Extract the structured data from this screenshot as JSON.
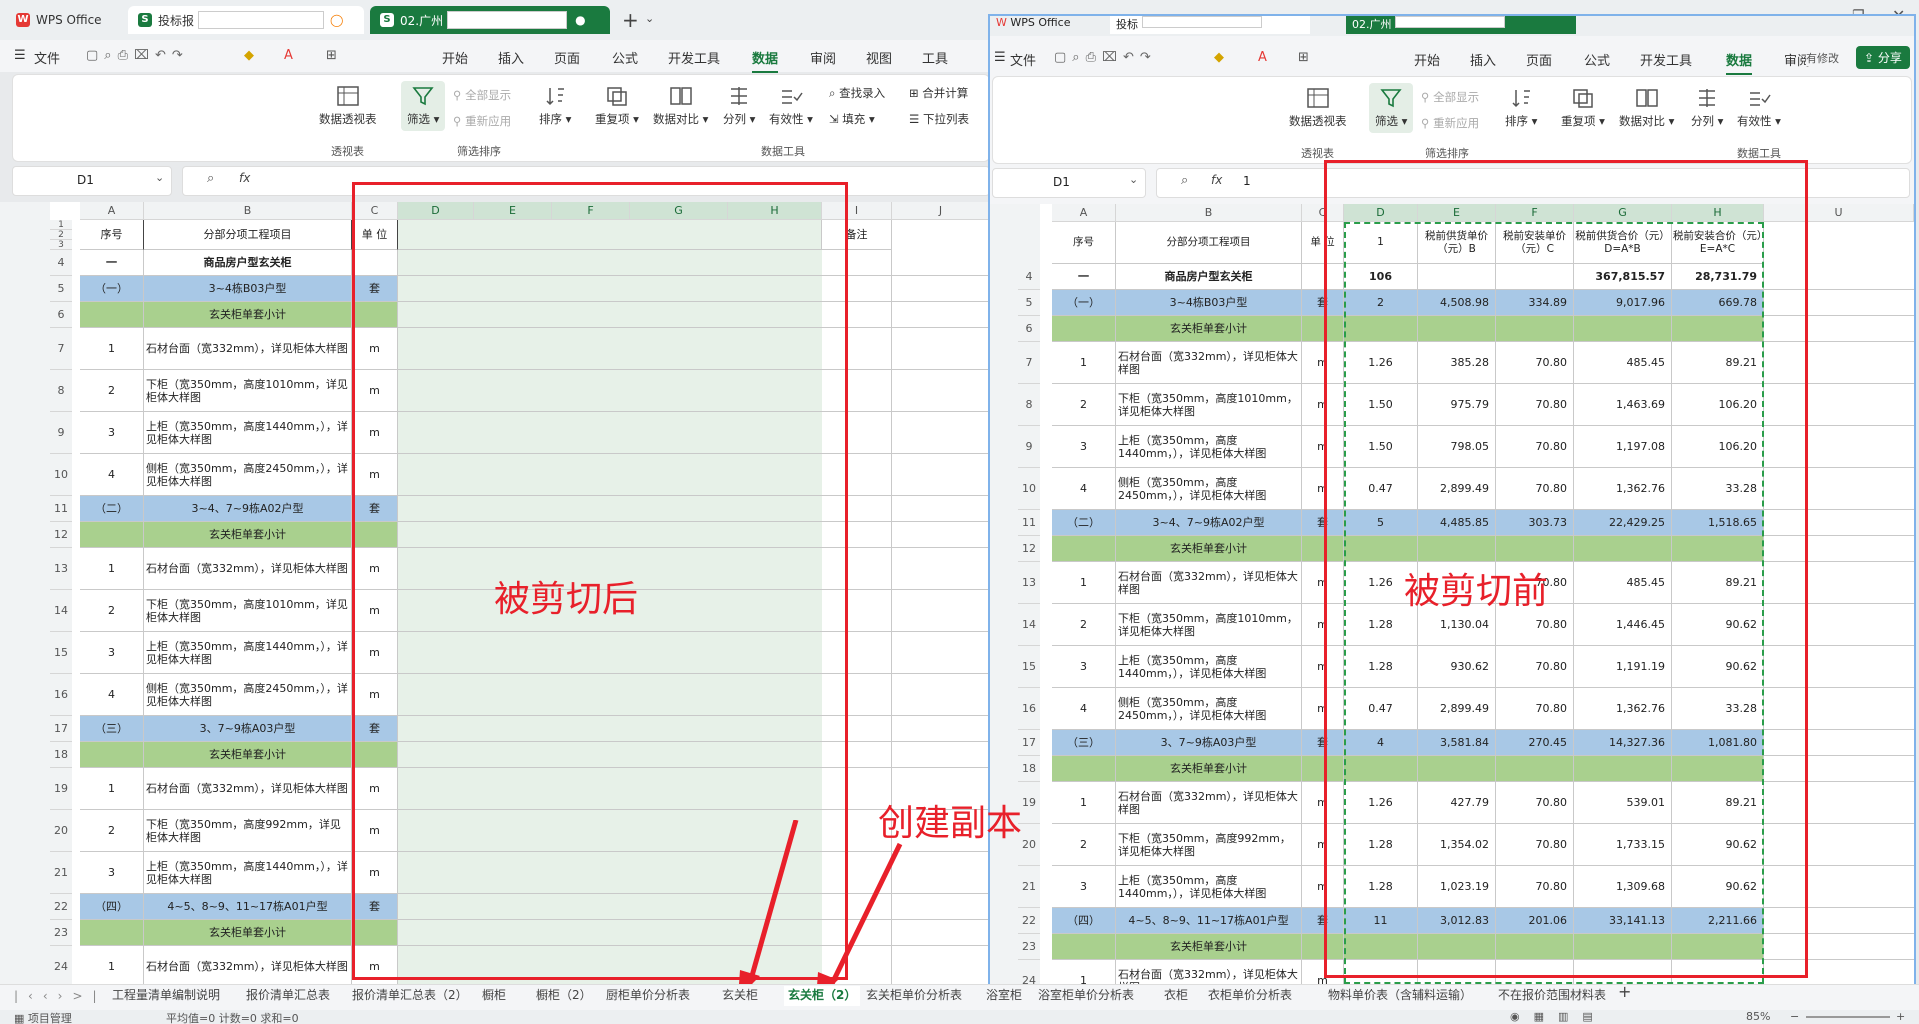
{
  "app": {
    "name": "WPS Office"
  },
  "tabs": [
    {
      "label": "WPS Office"
    },
    {
      "label": "投标报"
    },
    {
      "label": "02.广州"
    }
  ],
  "right_tabs": [
    {
      "label": "WPS Office"
    },
    {
      "label": "投标"
    },
    {
      "label": "02.广州"
    }
  ],
  "menu": {
    "file": "文件",
    "items": [
      "开始",
      "插入",
      "页面",
      "公式",
      "开发工具",
      "数据",
      "审阅",
      "视图",
      "工具"
    ],
    "active": "数据",
    "right_items": [
      "开始",
      "插入",
      "页面",
      "公式",
      "开发工具",
      "数据",
      "审阅"
    ],
    "has_edit": "有修改",
    "share": "分享"
  },
  "ribbon": {
    "pivot": "数据透视表",
    "filter": "筛选",
    "show_all": "全部显示",
    "reapply": "重新应用",
    "sort": "排序",
    "dup": "重复项",
    "compare": "数据对比",
    "split": "分列",
    "validity": "有效性",
    "lookup": "查找录入",
    "fill": "填充",
    "merge_calc": "合并计算",
    "dropdown": "下拉列表",
    "grp_pivot": "透视表",
    "grp_sort": "筛选排序",
    "grp_tools": "数据工具"
  },
  "formula": {
    "left_ref": "D1",
    "right_ref": "D1",
    "right_value": "1",
    "fx": "fx"
  },
  "grid_left": {
    "cols": [
      "A",
      "B",
      "C",
      "D",
      "E",
      "F",
      "G",
      "H",
      "I",
      "J"
    ],
    "header": {
      "seq": "序号",
      "item": "分部分项工程项目",
      "unit": "单 位",
      "note": "备注"
    },
    "rows": [
      {
        "n": "4",
        "seq": "一",
        "item": "商品房户型玄关柜",
        "unit": "",
        "type": "bold"
      },
      {
        "n": "5",
        "seq": "（一）",
        "item": "3~4栋B03户型",
        "unit": "套",
        "type": "blue"
      },
      {
        "n": "6",
        "seq": "",
        "item": "玄关柜单套小计",
        "unit": "",
        "type": "green"
      },
      {
        "n": "7",
        "seq": "1",
        "item": "石材台面（宽332mm），详见柜体大样图",
        "unit": "m",
        "type": "n"
      },
      {
        "n": "8",
        "seq": "2",
        "item": "下柜（宽350mm，高度1010mm，详见柜体大样图",
        "unit": "m",
        "type": "n"
      },
      {
        "n": "9",
        "seq": "3",
        "item": "上柜（宽350mm，高度1440mm，），详见柜体大样图",
        "unit": "m",
        "type": "n"
      },
      {
        "n": "10",
        "seq": "4",
        "item": "侧柜（宽350mm，高度2450mm，），详见柜体大样图",
        "unit": "m",
        "type": "n"
      },
      {
        "n": "11",
        "seq": "（二）",
        "item": "3~4、7~9栋A02户型",
        "unit": "套",
        "type": "blue"
      },
      {
        "n": "12",
        "seq": "",
        "item": "玄关柜单套小计",
        "unit": "",
        "type": "green"
      },
      {
        "n": "13",
        "seq": "1",
        "item": "石材台面（宽332mm），详见柜体大样图",
        "unit": "m",
        "type": "n"
      },
      {
        "n": "14",
        "seq": "2",
        "item": "下柜（宽350mm，高度1010mm，详见柜体大样图",
        "unit": "m",
        "type": "n"
      },
      {
        "n": "15",
        "seq": "3",
        "item": "上柜（宽350mm，高度1440mm，），详见柜体大样图",
        "unit": "m",
        "type": "n"
      },
      {
        "n": "16",
        "seq": "4",
        "item": "侧柜（宽350mm，高度2450mm，），详见柜体大样图",
        "unit": "m",
        "type": "n"
      },
      {
        "n": "17",
        "seq": "（三）",
        "item": "3、7~9栋A03户型",
        "unit": "套",
        "type": "blue"
      },
      {
        "n": "18",
        "seq": "",
        "item": "玄关柜单套小计",
        "unit": "",
        "type": "green"
      },
      {
        "n": "19",
        "seq": "1",
        "item": "石材台面（宽332mm），详见柜体大样图",
        "unit": "m",
        "type": "n"
      },
      {
        "n": "20",
        "seq": "2",
        "item": "下柜（宽350mm，高度992mm，详见柜体大样图",
        "unit": "m",
        "type": "n"
      },
      {
        "n": "21",
        "seq": "3",
        "item": "上柜（宽350mm，高度1440mm，），详见柜体大样图",
        "unit": "m",
        "type": "n"
      },
      {
        "n": "22",
        "seq": "（四）",
        "item": "4~5、8~9、11~17栋A01户型",
        "unit": "套",
        "type": "blue"
      },
      {
        "n": "23",
        "seq": "",
        "item": "玄关柜单套小计",
        "unit": "",
        "type": "green"
      },
      {
        "n": "24",
        "seq": "1",
        "item": "石材台面（宽332mm），详见柜体大样图",
        "unit": "m",
        "type": "n"
      }
    ]
  },
  "grid_right": {
    "cols": [
      "A",
      "B",
      "C",
      "D",
      "E",
      "F",
      "G",
      "H",
      "U"
    ],
    "header": {
      "seq": "序号",
      "item": "分部分项工程项目",
      "unit": "单 位",
      "d": "1",
      "e": "税前供货单价（元）B",
      "f": "税前安装单价（元）C",
      "g": "税前供货合价（元）D=A*B",
      "h": "税前安装合价（元）E=A*C"
    },
    "rows": [
      {
        "n": "4",
        "seq": "一",
        "item": "商品房户型玄关柜",
        "unit": "",
        "d": "106",
        "e": "",
        "f": "",
        "g": "367,815.57",
        "h": "28,731.79",
        "type": "bold"
      },
      {
        "n": "5",
        "seq": "（一）",
        "item": "3~4栋B03户型",
        "unit": "套",
        "d": "2",
        "e": "4,508.98",
        "f": "334.89",
        "g": "9,017.96",
        "h": "669.78",
        "type": "blue"
      },
      {
        "n": "6",
        "seq": "",
        "item": "玄关柜单套小计",
        "unit": "",
        "d": "",
        "e": "",
        "f": "",
        "g": "",
        "h": "",
        "type": "green"
      },
      {
        "n": "7",
        "seq": "1",
        "item": "石材台面（宽332mm），详见柜体大样图",
        "unit": "m",
        "d": "1.26",
        "e": "385.28",
        "f": "70.80",
        "g": "485.45",
        "h": "89.21",
        "type": "n"
      },
      {
        "n": "8",
        "seq": "2",
        "item": "下柜（宽350mm，高度1010mm，详见柜体大样图",
        "unit": "m",
        "d": "1.50",
        "e": "975.79",
        "f": "70.80",
        "g": "1,463.69",
        "h": "106.20",
        "type": "n"
      },
      {
        "n": "9",
        "seq": "3",
        "item": "上柜（宽350mm，高度1440mm，），详见柜体大样图",
        "unit": "m",
        "d": "1.50",
        "e": "798.05",
        "f": "70.80",
        "g": "1,197.08",
        "h": "106.20",
        "type": "n"
      },
      {
        "n": "10",
        "seq": "4",
        "item": "侧柜（宽350mm，高度2450mm，），详见柜体大样图",
        "unit": "m",
        "d": "0.47",
        "e": "2,899.49",
        "f": "70.80",
        "g": "1,362.76",
        "h": "33.28",
        "type": "n"
      },
      {
        "n": "11",
        "seq": "（二）",
        "item": "3~4、7~9栋A02户型",
        "unit": "套",
        "d": "5",
        "e": "4,485.85",
        "f": "303.73",
        "g": "22,429.25",
        "h": "1,518.65",
        "type": "blue"
      },
      {
        "n": "12",
        "seq": "",
        "item": "玄关柜单套小计",
        "unit": "",
        "d": "",
        "e": "",
        "f": "",
        "g": "",
        "h": "",
        "type": "green"
      },
      {
        "n": "13",
        "seq": "1",
        "item": "石材台面（宽332mm），详见柜体大样图",
        "unit": "m",
        "d": "1.26",
        "e": "",
        "f": "70.80",
        "g": "485.45",
        "h": "89.21",
        "type": "n"
      },
      {
        "n": "14",
        "seq": "2",
        "item": "下柜（宽350mm，高度1010mm，详见柜体大样图",
        "unit": "m",
        "d": "1.28",
        "e": "1,130.04",
        "f": "70.80",
        "g": "1,446.45",
        "h": "90.62",
        "type": "n"
      },
      {
        "n": "15",
        "seq": "3",
        "item": "上柜（宽350mm，高度1440mm，），详见柜体大样图",
        "unit": "m",
        "d": "1.28",
        "e": "930.62",
        "f": "70.80",
        "g": "1,191.19",
        "h": "90.62",
        "type": "n"
      },
      {
        "n": "16",
        "seq": "4",
        "item": "侧柜（宽350mm，高度2450mm，），详见柜体大样图",
        "unit": "m",
        "d": "0.47",
        "e": "2,899.49",
        "f": "70.80",
        "g": "1,362.76",
        "h": "33.28",
        "type": "n"
      },
      {
        "n": "17",
        "seq": "（三）",
        "item": "3、7~9栋A03户型",
        "unit": "套",
        "d": "4",
        "e": "3,581.84",
        "f": "270.45",
        "g": "14,327.36",
        "h": "1,081.80",
        "type": "blue"
      },
      {
        "n": "18",
        "seq": "",
        "item": "玄关柜单套小计",
        "unit": "",
        "d": "",
        "e": "",
        "f": "",
        "g": "",
        "h": "",
        "type": "green"
      },
      {
        "n": "19",
        "seq": "1",
        "item": "石材台面（宽332mm），详见柜体大样图",
        "unit": "m",
        "d": "1.26",
        "e": "427.79",
        "f": "70.80",
        "g": "539.01",
        "h": "89.21",
        "type": "n"
      },
      {
        "n": "20",
        "seq": "2",
        "item": "下柜（宽350mm，高度992mm，详见柜体大样图",
        "unit": "m",
        "d": "1.28",
        "e": "1,354.02",
        "f": "70.80",
        "g": "1,733.15",
        "h": "90.62",
        "type": "n"
      },
      {
        "n": "21",
        "seq": "3",
        "item": "上柜（宽350mm，高度1440mm，），详见柜体大样图",
        "unit": "m",
        "d": "1.28",
        "e": "1,023.19",
        "f": "70.80",
        "g": "1,309.68",
        "h": "90.62",
        "type": "n"
      },
      {
        "n": "22",
        "seq": "（四）",
        "item": "4~5、8~9、11~17栋A01户型",
        "unit": "套",
        "d": "11",
        "e": "3,012.83",
        "f": "201.06",
        "g": "33,141.13",
        "h": "2,211.66",
        "type": "blue"
      },
      {
        "n": "23",
        "seq": "",
        "item": "玄关柜单套小计",
        "unit": "",
        "d": "",
        "e": "",
        "f": "",
        "g": "",
        "h": "",
        "type": "green"
      },
      {
        "n": "24",
        "seq": "1",
        "item": "石材台面（宽332mm），详见柜体大样图",
        "unit": "m",
        "d": "",
        "e": "",
        "f": "",
        "g": "",
        "h": "",
        "type": "n"
      }
    ]
  },
  "annotations": {
    "after": "被剪切后",
    "before": "被剪切前",
    "copy": "创建副本"
  },
  "sheets": [
    "工程量清单编制说明",
    "报价清单汇总表",
    "报价清单汇总表（2）",
    "橱柜",
    "橱柜（2）",
    "厨柜单价分析表",
    "玄关柜",
    "玄关柜（2）",
    "玄关柜单价分析表",
    "浴室柜",
    "浴室柜单价分析表",
    "衣柜",
    "衣柜单价分析表",
    "物料单价表（含辅料运输）",
    "不在报价范围材料表"
  ],
  "active_sheet": "玄关柜（2）",
  "status": {
    "left": "项目管理",
    "stats": "平均值=0  计数=0  求和=0",
    "zoom": "85%"
  },
  "colors": {
    "accent": "#1a7a3f",
    "annotation": "#e8202a",
    "blue_row": "#a8c8e6",
    "green_row": "#a9d08e"
  }
}
